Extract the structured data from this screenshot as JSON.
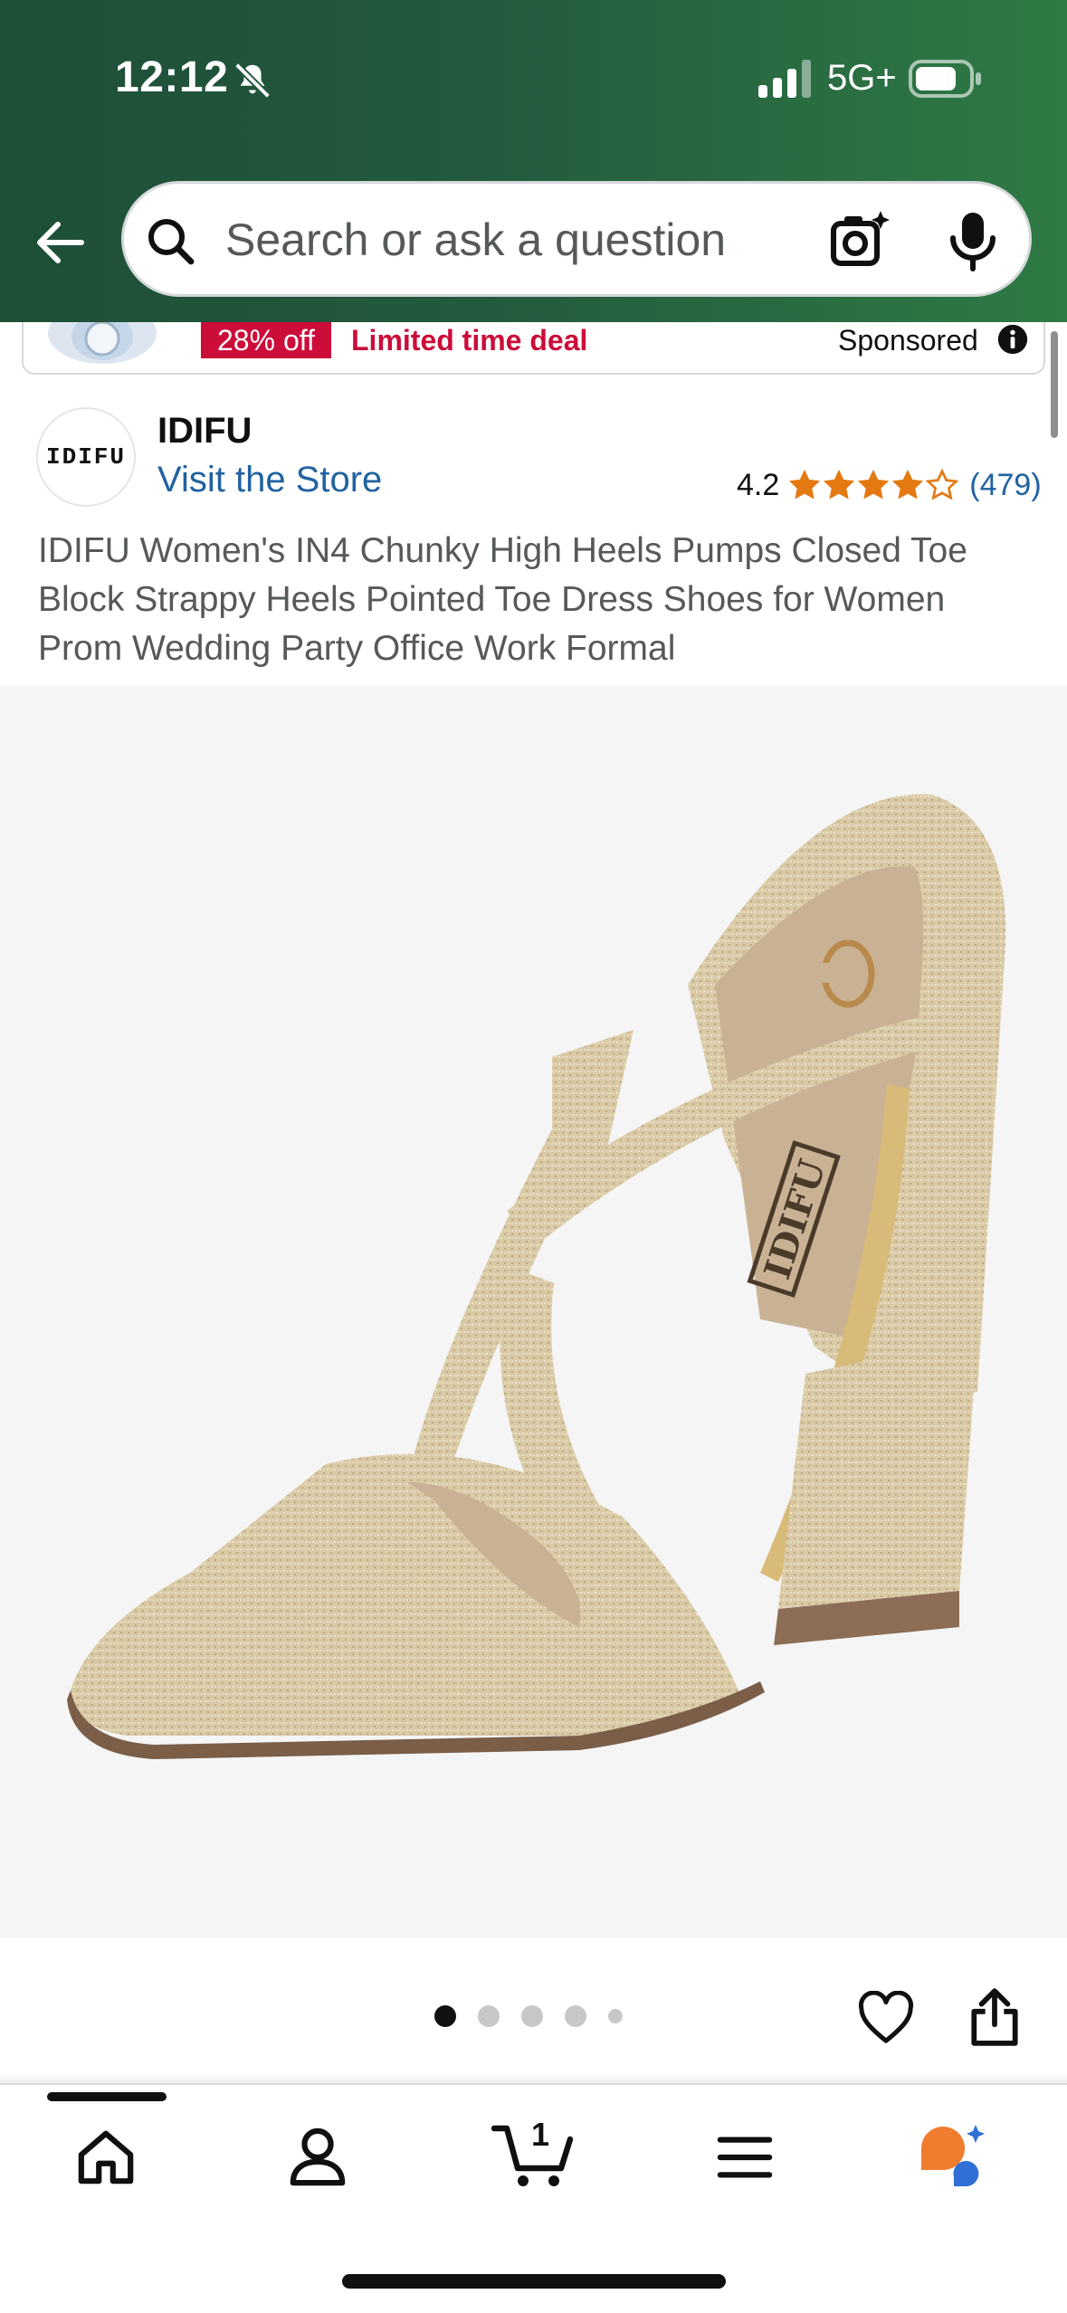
{
  "status_bar": {
    "time": "12:12",
    "network": "5G+",
    "icons": [
      "bell-slash-icon",
      "signal-icon",
      "battery-icon"
    ]
  },
  "search": {
    "placeholder": "Search or ask a question",
    "icons": [
      "back-arrow-icon",
      "search-icon",
      "camera-icon",
      "microphone-icon"
    ]
  },
  "ad": {
    "discount": "28% off",
    "deal_label": "Limited time deal",
    "sponsored": "Sponsored"
  },
  "brand": {
    "logo_text": "IDIFU",
    "name": "IDIFU",
    "store_link": "Visit the Store"
  },
  "rating": {
    "value": "4.2",
    "stars": 4.2,
    "count": "(479)"
  },
  "product": {
    "title": "IDIFU Women's IN4 Chunky High Heels Pumps Closed Toe Block Strappy Heels Pointed Toe Dress Shoes for Women Prom Wedding Party Office Work Formal",
    "insole_text": "IDIFU"
  },
  "carousel": {
    "total": 5,
    "active": 1
  },
  "nav": {
    "cart_count": "1",
    "items": [
      "home-icon",
      "account-icon",
      "cart-icon",
      "menu-icon",
      "rufus-icon"
    ],
    "active": "home"
  },
  "colors": {
    "header_green": "#235a3e",
    "deal_red": "#cc0c39",
    "link_blue": "#2162a1",
    "star_orange": "#e47911"
  }
}
